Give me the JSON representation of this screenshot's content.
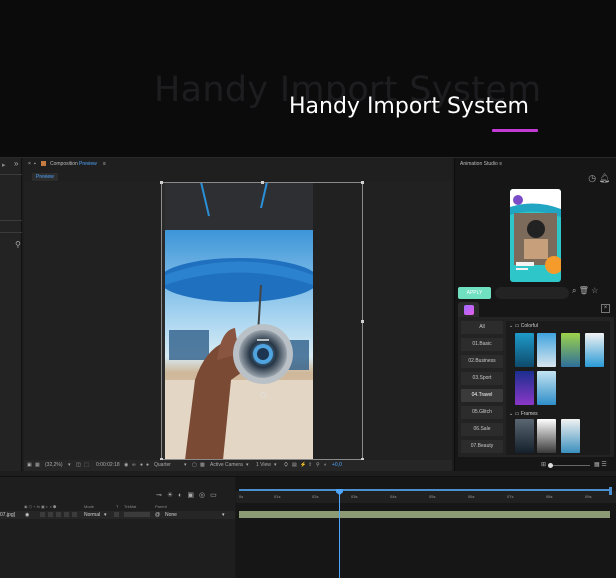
{
  "hero": {
    "ghost_title": "Handy Import System",
    "title": "Handy Import System",
    "accent_color": "#c23bd4"
  },
  "composition": {
    "panel_title": "Composition",
    "panel_title_highlight": "Preview",
    "tab_label": "Preview",
    "footer": {
      "zoom": "(32,2%)",
      "timecode": "0:00:02:18",
      "resolution": "Quarter",
      "camera": "Active Camera",
      "view": "1 View",
      "exposure": "+0,0"
    }
  },
  "studio": {
    "panel_title": "Animation Studio",
    "apply_label": "APPLY",
    "apply_color": "#6fe0c0",
    "categories": [
      "All",
      "01.Basic",
      "02.Business",
      "03.Sport",
      "04.Travel",
      "05.Glitch",
      "06.Sale",
      "07.Beauty"
    ],
    "active_category": "04.Travel",
    "groups": [
      "Colorful",
      "Frames"
    ],
    "icons": [
      "clock-icon",
      "bell-icon",
      "search-icon",
      "trash-icon",
      "star-icon",
      "close-icon"
    ]
  },
  "timeline": {
    "ruler_ticks": [
      "0s",
      "01s",
      "02s",
      "03s",
      "04s",
      "05s",
      "06s",
      "07s",
      "08s",
      "09s"
    ],
    "columns": [
      "Mode",
      "T",
      "TrkMat",
      "Parent"
    ],
    "layer": {
      "name": "07.jpg]",
      "mode": "Normal",
      "parent": "None"
    }
  }
}
